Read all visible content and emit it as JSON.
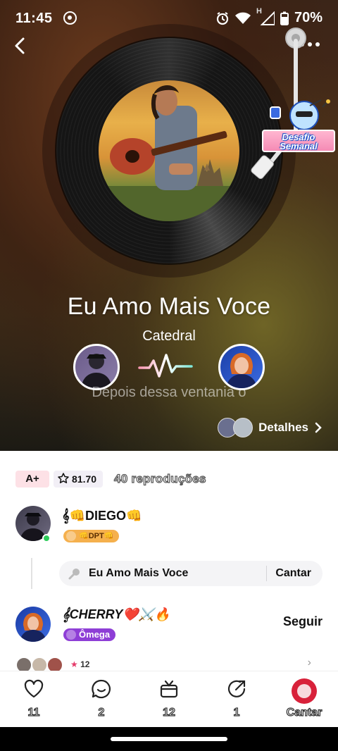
{
  "status_bar": {
    "time": "11:45",
    "battery": "70%",
    "network_letter": "H"
  },
  "player": {
    "song_title": "Eu Amo Mais Voce",
    "artist": "Catedral",
    "lyric_line": "Depois dessa ventania o",
    "details_label": "Detalhes",
    "challenge_label": "Desafio Semanal"
  },
  "stats": {
    "grade": "A+",
    "score": "81.70",
    "plays": "40 reproduções"
  },
  "users": [
    {
      "name": "𝄞👊DIEGO👊",
      "tag": "👊DPT👊",
      "online": true
    },
    {
      "name": "𝄞CHERRY❤️⚔️🔥",
      "tag": "Ômega",
      "follow_label": "Seguir"
    }
  ],
  "song_chip": {
    "title": "Eu Amo Mais Voce",
    "sing_label": "Cantar"
  },
  "comments": {
    "count": "12"
  },
  "actions": [
    {
      "icon": "heart-icon",
      "label": "11"
    },
    {
      "icon": "comment-icon",
      "label": "2"
    },
    {
      "icon": "gift-icon",
      "label": "12"
    },
    {
      "icon": "share-icon",
      "label": "1"
    },
    {
      "icon": "sing-icon",
      "label": "Cantar"
    }
  ],
  "colors": {
    "accent_red": "#d8213a",
    "grade_bg": "#fde1e6",
    "omega_purple": "#8e3ed6",
    "dpt_orange": "#f5b04d",
    "online_green": "#2ecc5b"
  }
}
